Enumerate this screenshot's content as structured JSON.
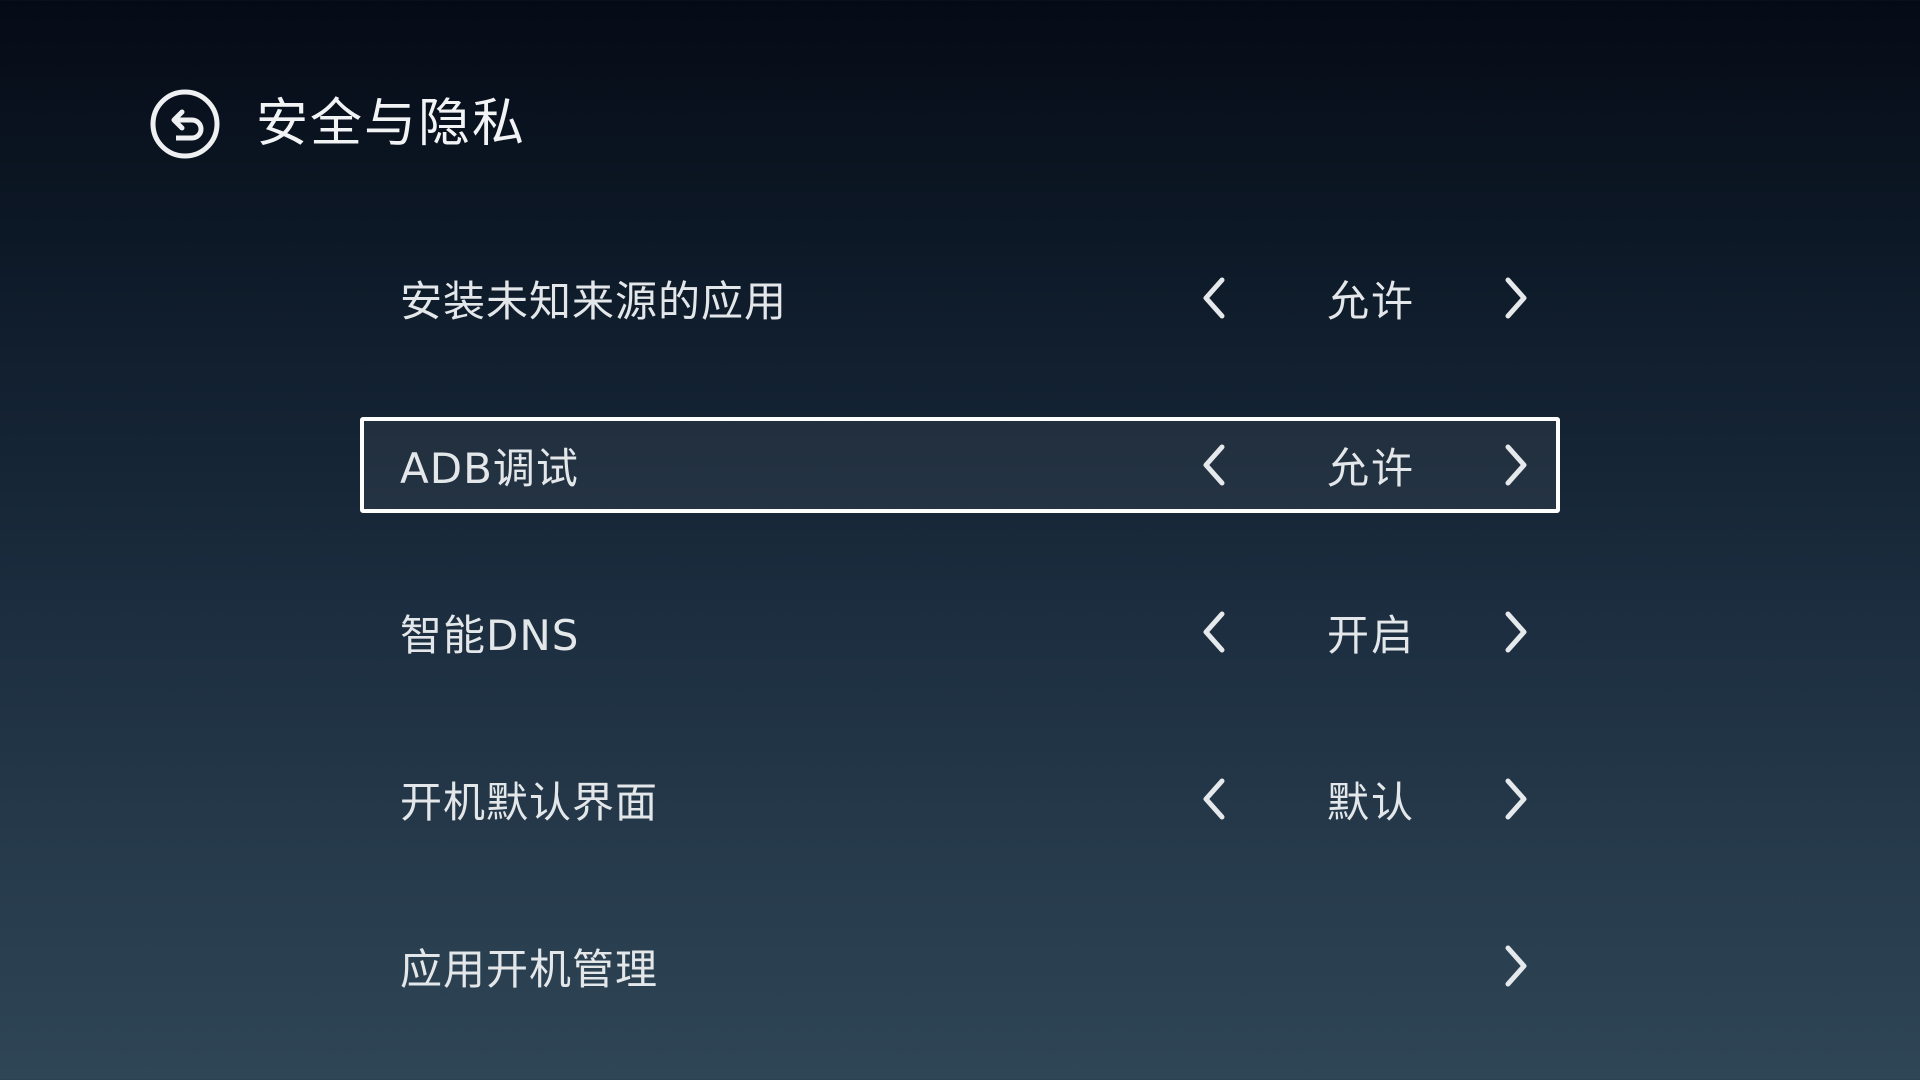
{
  "header": {
    "back_icon": "back-arrow-circle-icon",
    "title": "安全与隐私"
  },
  "settings": [
    {
      "label": "安装未知来源的应用",
      "value": "允许",
      "has_prev": true,
      "has_next": true,
      "selected": false
    },
    {
      "label": "ADB调试",
      "value": "允许",
      "has_prev": true,
      "has_next": true,
      "selected": true
    },
    {
      "label": "智能DNS",
      "value": "开启",
      "has_prev": true,
      "has_next": true,
      "selected": false
    },
    {
      "label": "开机默认界面",
      "value": "默认",
      "has_prev": true,
      "has_next": true,
      "selected": false
    },
    {
      "label": "应用开机管理",
      "value": "",
      "has_prev": false,
      "has_next": true,
      "selected": false
    }
  ],
  "icons": {
    "prev": "chevron-left-icon",
    "next": "chevron-right-icon"
  },
  "colors": {
    "background_top": "#050b16",
    "background_bottom": "#2f4656",
    "text": "#e4e7ea",
    "focus_border": "#ffffff"
  }
}
